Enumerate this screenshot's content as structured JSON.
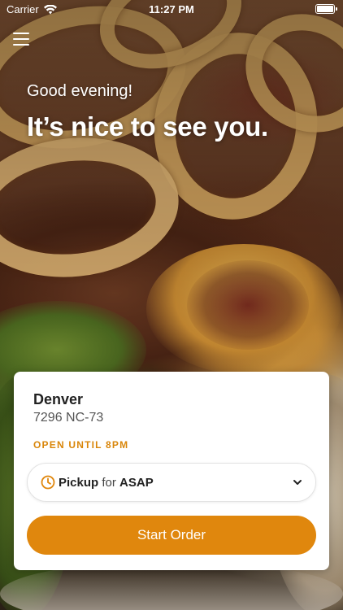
{
  "status_bar": {
    "carrier": "Carrier",
    "time": "11:27 PM"
  },
  "greeting": {
    "salutation": "Good evening!",
    "headline": "It’s nice to see you."
  },
  "location": {
    "name": "Denver",
    "address": "7296 NC-73",
    "hours": "OPEN UNTIL 8PM"
  },
  "order": {
    "type": "Pickup",
    "connector": "for",
    "time": "ASAP"
  },
  "actions": {
    "start_order": "Start Order"
  },
  "icons": {
    "menu": "hamburger-menu-icon",
    "clock": "clock-icon",
    "chevron": "chevron-down-icon",
    "wifi": "wifi-icon",
    "battery": "battery-icon"
  },
  "colors": {
    "accent": "#e0870d",
    "hours_text": "#d9860a",
    "card_bg": "#ffffff"
  }
}
